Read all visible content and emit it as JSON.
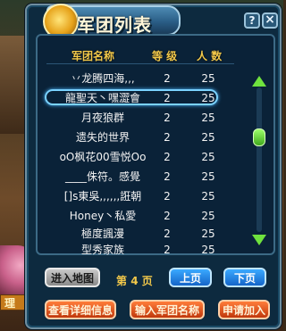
{
  "window": {
    "title": "军团列表",
    "help_label": "?",
    "close_label": "×"
  },
  "columns": {
    "name": "军团名称",
    "level": "等 级",
    "members": "人 数"
  },
  "rows": [
    {
      "name": "丷龙腾四海,,,",
      "level": "2",
      "members": "25"
    },
    {
      "name": "龍聖天丶嘿澀會",
      "level": "2",
      "members": "25"
    },
    {
      "name": "月夜狼群",
      "level": "2",
      "members": "25"
    },
    {
      "name": "遗失的世界",
      "level": "2",
      "members": "25"
    },
    {
      "name": "oO枫花00雪悦Oo",
      "level": "2",
      "members": "25"
    },
    {
      "name": "____侏符。感覺",
      "level": "2",
      "members": "25"
    },
    {
      "name": "[]s東吳,,,,,,誑朝",
      "level": "2",
      "members": "25"
    },
    {
      "name": "Honey丶私愛",
      "level": "2",
      "members": "25"
    },
    {
      "name": "極度諷漫",
      "level": "2",
      "members": "25"
    },
    {
      "name": "型秀家族",
      "level": "2",
      "members": "25"
    }
  ],
  "selected_row": 1,
  "footer": {
    "enter_map": "进入地图",
    "page_prefix": "第",
    "page_number": "4",
    "page_suffix": "页",
    "prev_page": "上页",
    "next_page": "下页",
    "view_details": "查看详细信息",
    "enter_name": "输入军团名称",
    "apply_join": "申请加入"
  },
  "background": {
    "side_tag": "理"
  },
  "colors": {
    "header_gold": "#f2c84a",
    "select_blue": "#7bd3ff",
    "scroll_green": "#6fe23e",
    "button_blue": "#1565c8",
    "button_orange": "#c0380c"
  }
}
